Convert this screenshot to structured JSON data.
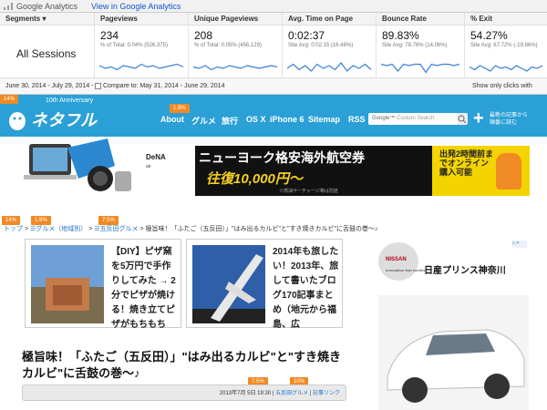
{
  "ga": {
    "product": "Google Analytics",
    "view_link": "View in Google Analytics",
    "segments_header": "Segments",
    "segment": "All Sessions",
    "metrics": [
      {
        "name": "Pageviews",
        "value": "234",
        "sub": "% of Total: 0.04% (526,375)",
        "trend": [
          6,
          4,
          5,
          3,
          6,
          5,
          4,
          7,
          5,
          6,
          4,
          5,
          6,
          7,
          5
        ]
      },
      {
        "name": "Unique Pageviews",
        "value": "208",
        "sub": "% of Total: 0.05% (456,129)",
        "trend": [
          5,
          4,
          6,
          3,
          5,
          4,
          6,
          5,
          4,
          6,
          5,
          4,
          5,
          6,
          5
        ]
      },
      {
        "name": "Avg. Time on Page",
        "value": "0:02:37",
        "sub": "Site Avg: 0:02:15 (16.48%)",
        "trend": [
          4,
          7,
          3,
          6,
          2,
          7,
          4,
          6,
          3,
          8,
          2,
          6,
          4,
          7,
          3
        ]
      },
      {
        "name": "Bounce Rate",
        "value": "89.83%",
        "sub": "Site Avg: 78.76% (14.06%)",
        "trend": [
          7,
          6,
          7,
          2,
          7,
          6,
          7,
          7,
          1,
          7,
          6,
          7,
          7,
          6,
          7
        ]
      },
      {
        "name": "% Exit",
        "value": "54.27%",
        "sub": "Site Avg: 67.72% (-19.86%)",
        "trend": [
          5,
          3,
          6,
          4,
          2,
          6,
          4,
          5,
          3,
          6,
          4,
          2,
          5,
          4,
          6
        ]
      }
    ],
    "date_range": "June 30, 2014 - July 29, 2014 -",
    "compare_label": "Compare to: May 31, 2014 - June 29, 2014",
    "clicks_label": "Show only clicks with more"
  },
  "site": {
    "anniversary": "10th Anniversary",
    "logo_text": "ネタフル",
    "nav": [
      "About",
      "グルメ",
      "旅行",
      "OS X",
      "iPhone 6",
      "Sitemap",
      "RSS"
    ],
    "search_placeholder": "Custom Search",
    "new_posts": "最新の記事から\n順番に読む",
    "badges": {
      "top_left": "14%",
      "nav_gourmet": "1.9%",
      "crumb_home": "14%",
      "crumb_gourmet": "1.9%",
      "crumb_local": "7.5%",
      "meta_date": "7.5%",
      "meta_cat": "10%"
    }
  },
  "banner": {
    "brand": "DeNA",
    "brand_sub": "air",
    "headline": "ニューヨーク格安海外航空券",
    "fare": "往復10,000円〜",
    "fine": "※燃油サーチャージ等は別途",
    "yellow": "出発2時間前までオンライン購入可能"
  },
  "breadcrumb": {
    "home": "トップ",
    "sep1": ">",
    "cat1": "グルメ（地域別）",
    "sep2": ">",
    "cat2": "五反田グルメ",
    "sep3": ">",
    "current": "極旨味！「ふたご（五反田）」\"はみ出るカルビ\"と\"すき焼きカルビ\"に舌鼓の巻〜♪"
  },
  "cards": [
    {
      "text": "【DIY】ピザ窯を5万円で手作りしてみた → 2分でピザが焼ける！焼き立てピザがもちもち"
    },
    {
      "text": "2014年も旅したい！2013年、旅して書いたブログ170記事まとめ（地元から福島、広"
    }
  ],
  "article": {
    "title": "極旨味！「ふたご（五反田）」\"はみ出るカルビ\"と\"すき焼きカルビ\"に舌鼓の巻〜♪",
    "date": "2013年7月 5日 19:30",
    "sep": "|",
    "category": "五反田グルメ",
    "link": "記事リンク"
  },
  "ad": {
    "brand": "NISSAN",
    "title": "日産プリンス神奈川",
    "tagline": "innovation that excites"
  }
}
